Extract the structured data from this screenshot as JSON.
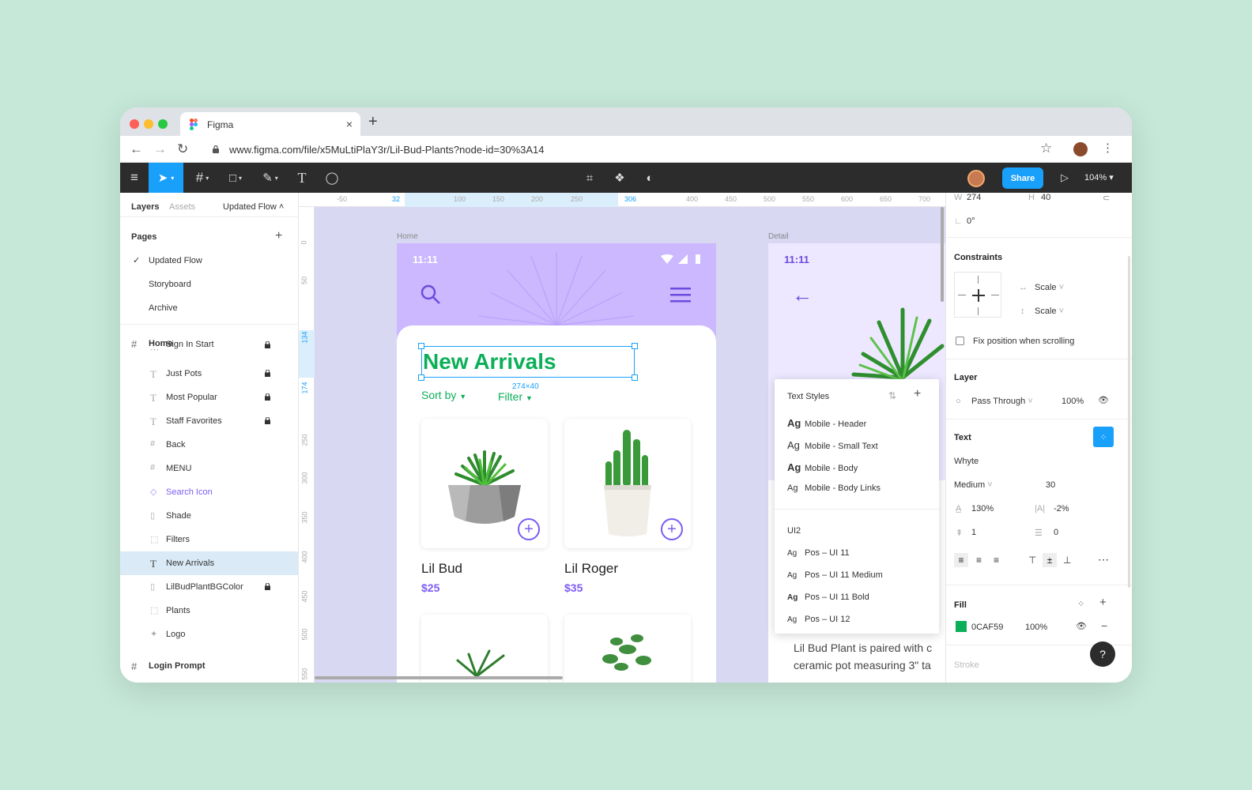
{
  "browser": {
    "tab_title": "Figma",
    "url": "www.figma.com/file/x5MuLtiPlaY3r/Lil-Bud-Plants?node-id=30%3A14"
  },
  "toolbar": {
    "share_label": "Share",
    "zoom": "104%"
  },
  "left_panel": {
    "tabs": {
      "layers": "Layers",
      "assets": "Assets",
      "page_selector": "Updated Flow"
    },
    "pages_title": "Pages",
    "pages": [
      "Updated Flow",
      "Storyboard",
      "Archive"
    ],
    "frame_home": "Home",
    "layers": [
      {
        "name": "Sign In Start",
        "icon": "frame"
      },
      {
        "name": "Just Pots",
        "icon": "text"
      },
      {
        "name": "Most Popular",
        "icon": "text"
      },
      {
        "name": "Staff Favorites",
        "icon": "text"
      },
      {
        "name": "Back",
        "icon": "frame"
      },
      {
        "name": "MENU",
        "icon": "frame"
      },
      {
        "name": "Search Icon",
        "icon": "component"
      },
      {
        "name": "Shade",
        "icon": "rect"
      },
      {
        "name": "Filters",
        "icon": "group"
      },
      {
        "name": "New Arrivals",
        "icon": "text"
      },
      {
        "name": "LilBudPlantBGColor",
        "icon": "rect"
      },
      {
        "name": "Plants",
        "icon": "group"
      },
      {
        "name": "Logo",
        "icon": "vector"
      }
    ],
    "frame_login": "Login Prompt"
  },
  "canvas": {
    "ruler_top": [
      "-50",
      "32",
      "100",
      "150",
      "200",
      "250",
      "306",
      "400",
      "450",
      "500",
      "550",
      "600",
      "650",
      "700"
    ],
    "ruler_left": [
      "0",
      "50",
      "134",
      "174",
      "250",
      "300",
      "350",
      "400",
      "450",
      "500",
      "550"
    ],
    "frame_home_label": "Home",
    "frame_detail_label": "Detail",
    "selection_size": "274×40"
  },
  "phone": {
    "time": "11:11",
    "heading": "New Arrivals",
    "sort_label": "Sort by",
    "filter_label": "Filter",
    "products": [
      {
        "name": "Lil Bud",
        "price": "$25"
      },
      {
        "name": "Lil Roger",
        "price": "$35"
      }
    ]
  },
  "detail": {
    "time": "11:11",
    "description_1": "Lil Bud Plant is paired with c",
    "description_2": "ceramic pot measuring 3\" ta"
  },
  "text_styles": {
    "title": "Text Styles",
    "styles": [
      "Mobile - Header",
      "Mobile - Small Text",
      "Mobile - Body",
      "Mobile - Body Links"
    ],
    "group": "UI2",
    "ui2_styles": [
      "Pos – UI 11",
      "Pos – UI 11 Medium",
      "Pos – UI 11 Bold",
      "Pos – UI 12"
    ]
  },
  "right_panel": {
    "w_label": "W",
    "w_value": "274",
    "h_label": "H",
    "h_value": "40",
    "rotation": "0°",
    "constraints_title": "Constraints",
    "constraint_h": "Scale",
    "constraint_v": "Scale",
    "fix_position": "Fix position when scrolling",
    "layer_title": "Layer",
    "blend": "Pass Through",
    "layer_opacity": "100%",
    "text_title": "Text",
    "font": "Whyte",
    "weight": "Medium",
    "size": "30",
    "line_height": "130%",
    "letter_spacing": "-2%",
    "paragraph_spacing": "1",
    "paragraph_indent": "0",
    "fill_title": "Fill",
    "fill_hex": "0CAF59",
    "fill_opacity": "100%",
    "stroke_title": "Stroke"
  },
  "colors": {
    "fill": "#0CAF59",
    "accent": "#18a0fb",
    "purple": "#7c5cf4"
  }
}
